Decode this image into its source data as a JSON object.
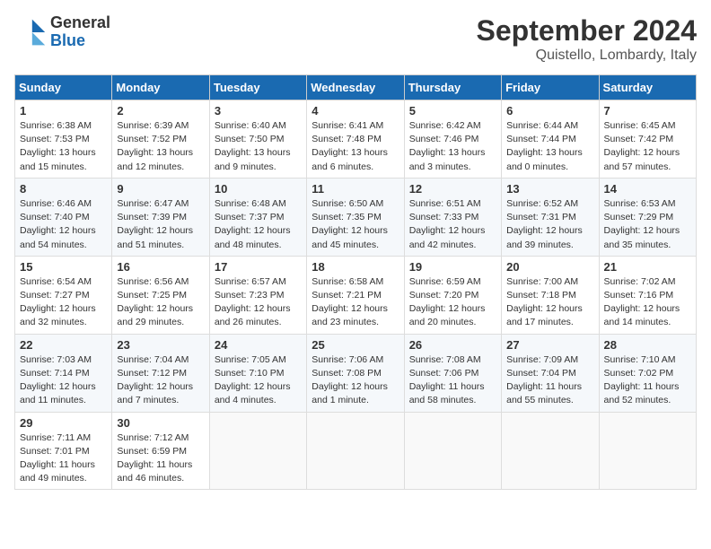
{
  "header": {
    "logo_general": "General",
    "logo_blue": "Blue",
    "month_year": "September 2024",
    "location": "Quistello, Lombardy, Italy"
  },
  "days_of_week": [
    "Sunday",
    "Monday",
    "Tuesday",
    "Wednesday",
    "Thursday",
    "Friday",
    "Saturday"
  ],
  "weeks": [
    [
      {
        "day": "1",
        "info": "Sunrise: 6:38 AM\nSunset: 7:53 PM\nDaylight: 13 hours\nand 15 minutes."
      },
      {
        "day": "2",
        "info": "Sunrise: 6:39 AM\nSunset: 7:52 PM\nDaylight: 13 hours\nand 12 minutes."
      },
      {
        "day": "3",
        "info": "Sunrise: 6:40 AM\nSunset: 7:50 PM\nDaylight: 13 hours\nand 9 minutes."
      },
      {
        "day": "4",
        "info": "Sunrise: 6:41 AM\nSunset: 7:48 PM\nDaylight: 13 hours\nand 6 minutes."
      },
      {
        "day": "5",
        "info": "Sunrise: 6:42 AM\nSunset: 7:46 PM\nDaylight: 13 hours\nand 3 minutes."
      },
      {
        "day": "6",
        "info": "Sunrise: 6:44 AM\nSunset: 7:44 PM\nDaylight: 13 hours\nand 0 minutes."
      },
      {
        "day": "7",
        "info": "Sunrise: 6:45 AM\nSunset: 7:42 PM\nDaylight: 12 hours\nand 57 minutes."
      }
    ],
    [
      {
        "day": "8",
        "info": "Sunrise: 6:46 AM\nSunset: 7:40 PM\nDaylight: 12 hours\nand 54 minutes."
      },
      {
        "day": "9",
        "info": "Sunrise: 6:47 AM\nSunset: 7:39 PM\nDaylight: 12 hours\nand 51 minutes."
      },
      {
        "day": "10",
        "info": "Sunrise: 6:48 AM\nSunset: 7:37 PM\nDaylight: 12 hours\nand 48 minutes."
      },
      {
        "day": "11",
        "info": "Sunrise: 6:50 AM\nSunset: 7:35 PM\nDaylight: 12 hours\nand 45 minutes."
      },
      {
        "day": "12",
        "info": "Sunrise: 6:51 AM\nSunset: 7:33 PM\nDaylight: 12 hours\nand 42 minutes."
      },
      {
        "day": "13",
        "info": "Sunrise: 6:52 AM\nSunset: 7:31 PM\nDaylight: 12 hours\nand 39 minutes."
      },
      {
        "day": "14",
        "info": "Sunrise: 6:53 AM\nSunset: 7:29 PM\nDaylight: 12 hours\nand 35 minutes."
      }
    ],
    [
      {
        "day": "15",
        "info": "Sunrise: 6:54 AM\nSunset: 7:27 PM\nDaylight: 12 hours\nand 32 minutes."
      },
      {
        "day": "16",
        "info": "Sunrise: 6:56 AM\nSunset: 7:25 PM\nDaylight: 12 hours\nand 29 minutes."
      },
      {
        "day": "17",
        "info": "Sunrise: 6:57 AM\nSunset: 7:23 PM\nDaylight: 12 hours\nand 26 minutes."
      },
      {
        "day": "18",
        "info": "Sunrise: 6:58 AM\nSunset: 7:21 PM\nDaylight: 12 hours\nand 23 minutes."
      },
      {
        "day": "19",
        "info": "Sunrise: 6:59 AM\nSunset: 7:20 PM\nDaylight: 12 hours\nand 20 minutes."
      },
      {
        "day": "20",
        "info": "Sunrise: 7:00 AM\nSunset: 7:18 PM\nDaylight: 12 hours\nand 17 minutes."
      },
      {
        "day": "21",
        "info": "Sunrise: 7:02 AM\nSunset: 7:16 PM\nDaylight: 12 hours\nand 14 minutes."
      }
    ],
    [
      {
        "day": "22",
        "info": "Sunrise: 7:03 AM\nSunset: 7:14 PM\nDaylight: 12 hours\nand 11 minutes."
      },
      {
        "day": "23",
        "info": "Sunrise: 7:04 AM\nSunset: 7:12 PM\nDaylight: 12 hours\nand 7 minutes."
      },
      {
        "day": "24",
        "info": "Sunrise: 7:05 AM\nSunset: 7:10 PM\nDaylight: 12 hours\nand 4 minutes."
      },
      {
        "day": "25",
        "info": "Sunrise: 7:06 AM\nSunset: 7:08 PM\nDaylight: 12 hours\nand 1 minute."
      },
      {
        "day": "26",
        "info": "Sunrise: 7:08 AM\nSunset: 7:06 PM\nDaylight: 11 hours\nand 58 minutes."
      },
      {
        "day": "27",
        "info": "Sunrise: 7:09 AM\nSunset: 7:04 PM\nDaylight: 11 hours\nand 55 minutes."
      },
      {
        "day": "28",
        "info": "Sunrise: 7:10 AM\nSunset: 7:02 PM\nDaylight: 11 hours\nand 52 minutes."
      }
    ],
    [
      {
        "day": "29",
        "info": "Sunrise: 7:11 AM\nSunset: 7:01 PM\nDaylight: 11 hours\nand 49 minutes."
      },
      {
        "day": "30",
        "info": "Sunrise: 7:12 AM\nSunset: 6:59 PM\nDaylight: 11 hours\nand 46 minutes."
      },
      {
        "day": "",
        "info": ""
      },
      {
        "day": "",
        "info": ""
      },
      {
        "day": "",
        "info": ""
      },
      {
        "day": "",
        "info": ""
      },
      {
        "day": "",
        "info": ""
      }
    ]
  ]
}
